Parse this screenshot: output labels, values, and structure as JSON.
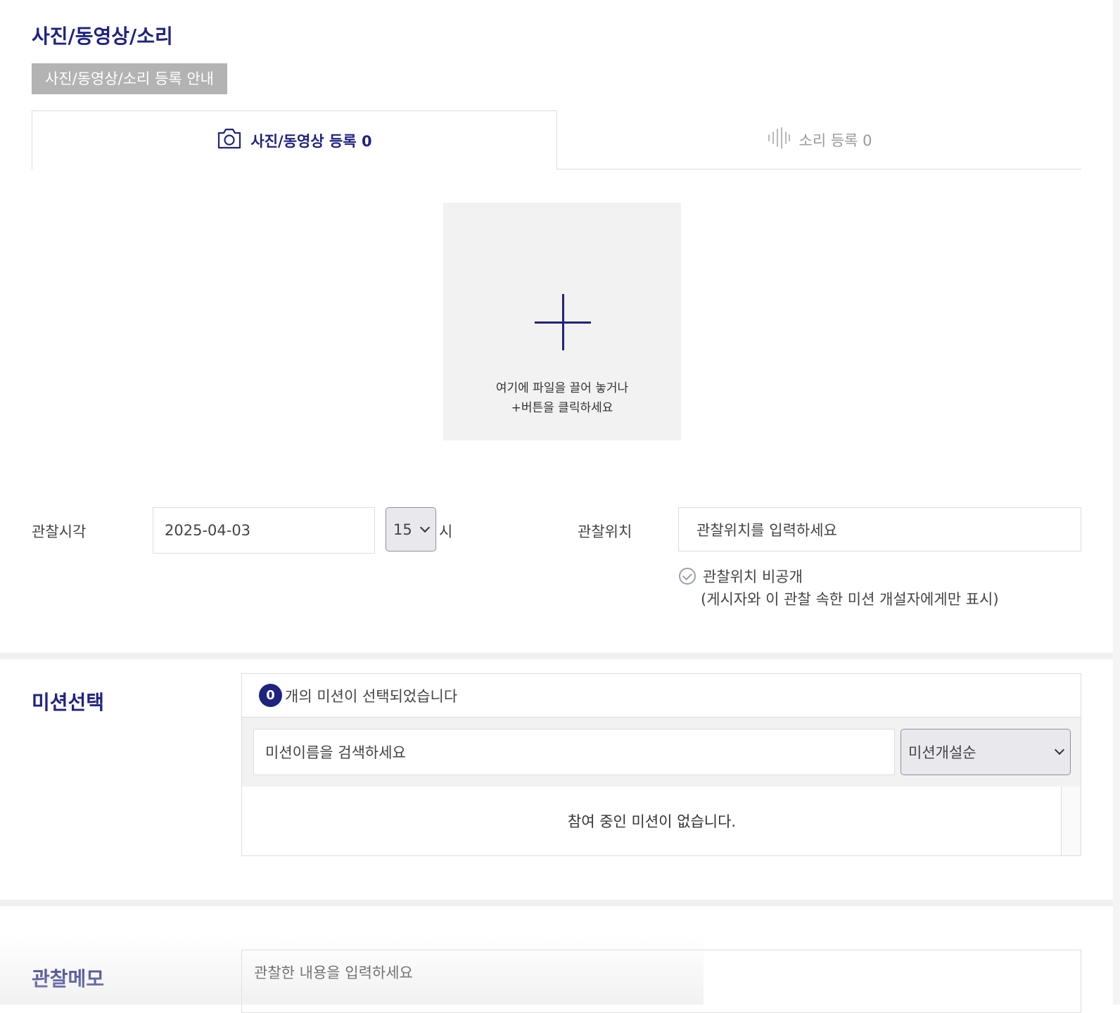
{
  "media": {
    "section_title": "사진/동영상/소리",
    "notice_button": "사진/동영상/소리 등록 안내",
    "tabs": [
      {
        "label": "사진/동영상 등록 0",
        "icon": "camera-icon",
        "active": true
      },
      {
        "label": "소리 등록 0",
        "icon": "sound-wave-icon",
        "active": false
      }
    ],
    "upload": {
      "line1": "여기에 파일을 끌어 놓거나",
      "line2": "+버튼을 클릭하세요"
    }
  },
  "observation": {
    "time_label": "관찰시각",
    "date_value": "2025-04-03",
    "hour_value": "15",
    "hour_unit": "시",
    "location_label": "관찰위치",
    "location_placeholder": "관찰위치를 입력하세요",
    "private_label": "관찰위치 비공개",
    "private_note": "(게시자와 이 관찰 속한 미션 개설자에게만 표시)"
  },
  "mission": {
    "section_title": "미션선택",
    "selected_count": "0",
    "selected_text": "개의 미션이 선택되었습니다",
    "search_placeholder": "미션이름을 검색하세요",
    "sort_value": "미션개설순",
    "empty_text": "참여 중인 미션이 없습니다."
  },
  "memo": {
    "section_title": "관찰메모",
    "placeholder": "관찰한 내용을 입력하세요"
  },
  "colors": {
    "accent": "#1e2380",
    "notice_bg": "#b3b3b3",
    "panel_bg": "#f2f2f2"
  }
}
